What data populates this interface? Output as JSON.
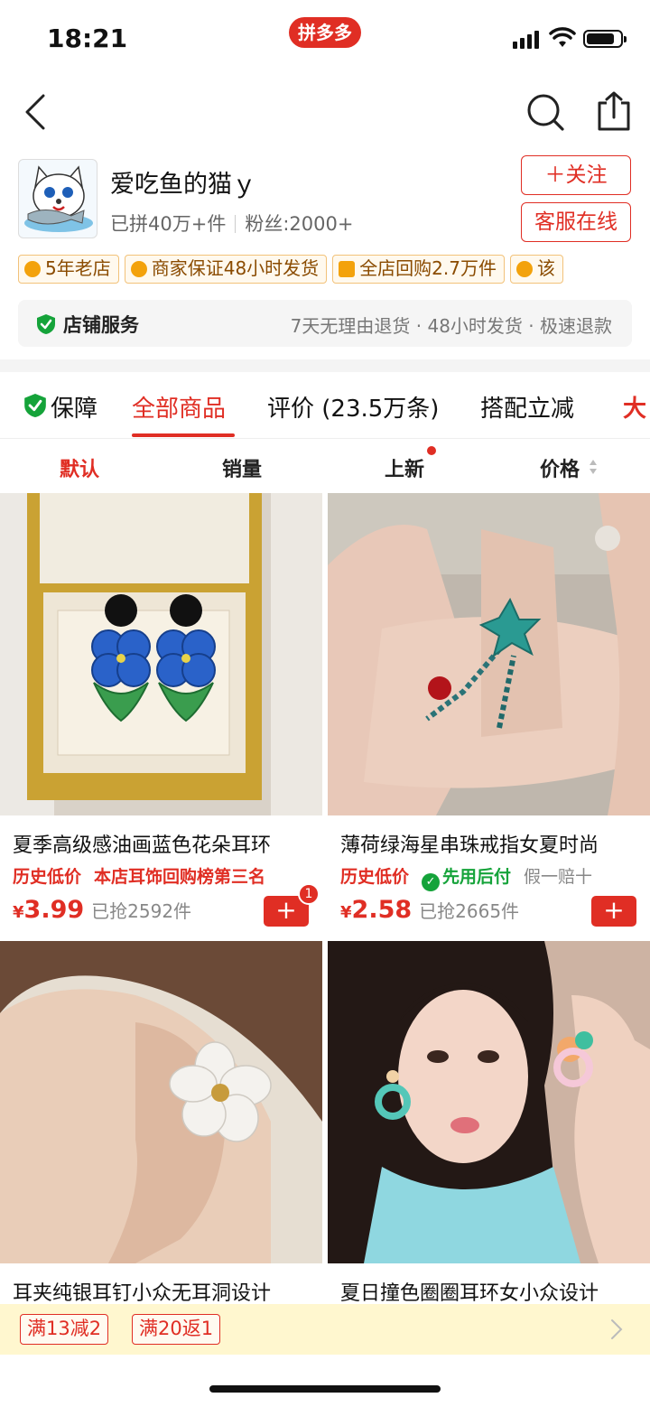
{
  "status_bar": {
    "time": "18:21",
    "app_badge": "拼多多"
  },
  "shop": {
    "name": "爱吃鱼的猫ｙ",
    "sold": "已拼40万+件",
    "fans": "粉丝:2000+",
    "follow_label": "＋关注",
    "service_label": "客服在线"
  },
  "tags": [
    "5年老店",
    "商家保证48小时发货",
    "全店回购2.7万件",
    "该"
  ],
  "services": {
    "title": "店铺服务",
    "list": "7天无理由退货 · 48小时发货 · 极速退款"
  },
  "tabs": [
    {
      "label": "保障"
    },
    {
      "label": "全部商品"
    },
    {
      "label": "评价 (23.5万条)"
    },
    {
      "label": "搭配立减"
    },
    {
      "label": "大"
    }
  ],
  "sort": [
    "默认",
    "销量",
    "上新",
    "价格"
  ],
  "products": [
    {
      "title": "夏季高级感油画蓝色花朵耳环",
      "badge1": "历史低价",
      "badge2": "本店耳饰回购榜第三名",
      "currency": "¥",
      "price": "3.99",
      "sold": "已抢2592件",
      "cart_count": "1"
    },
    {
      "title": "薄荷绿海星串珠戒指女夏时尚",
      "badge1": "历史低价",
      "badge2": "先用后付",
      "badge3": "假一赔十",
      "currency": "¥",
      "price": "2.58",
      "sold": "已抢2665件"
    },
    {
      "title": "耳夹纯银耳钉小众无耳洞设计"
    },
    {
      "title": "夏日撞色圈圈耳环女小众设计"
    }
  ],
  "promo": [
    "满13减2",
    "满20返1"
  ],
  "colors": {
    "accent": "#e02e24",
    "promo_bg": "#fff7cf",
    "tag_border": "#f2c27a"
  }
}
